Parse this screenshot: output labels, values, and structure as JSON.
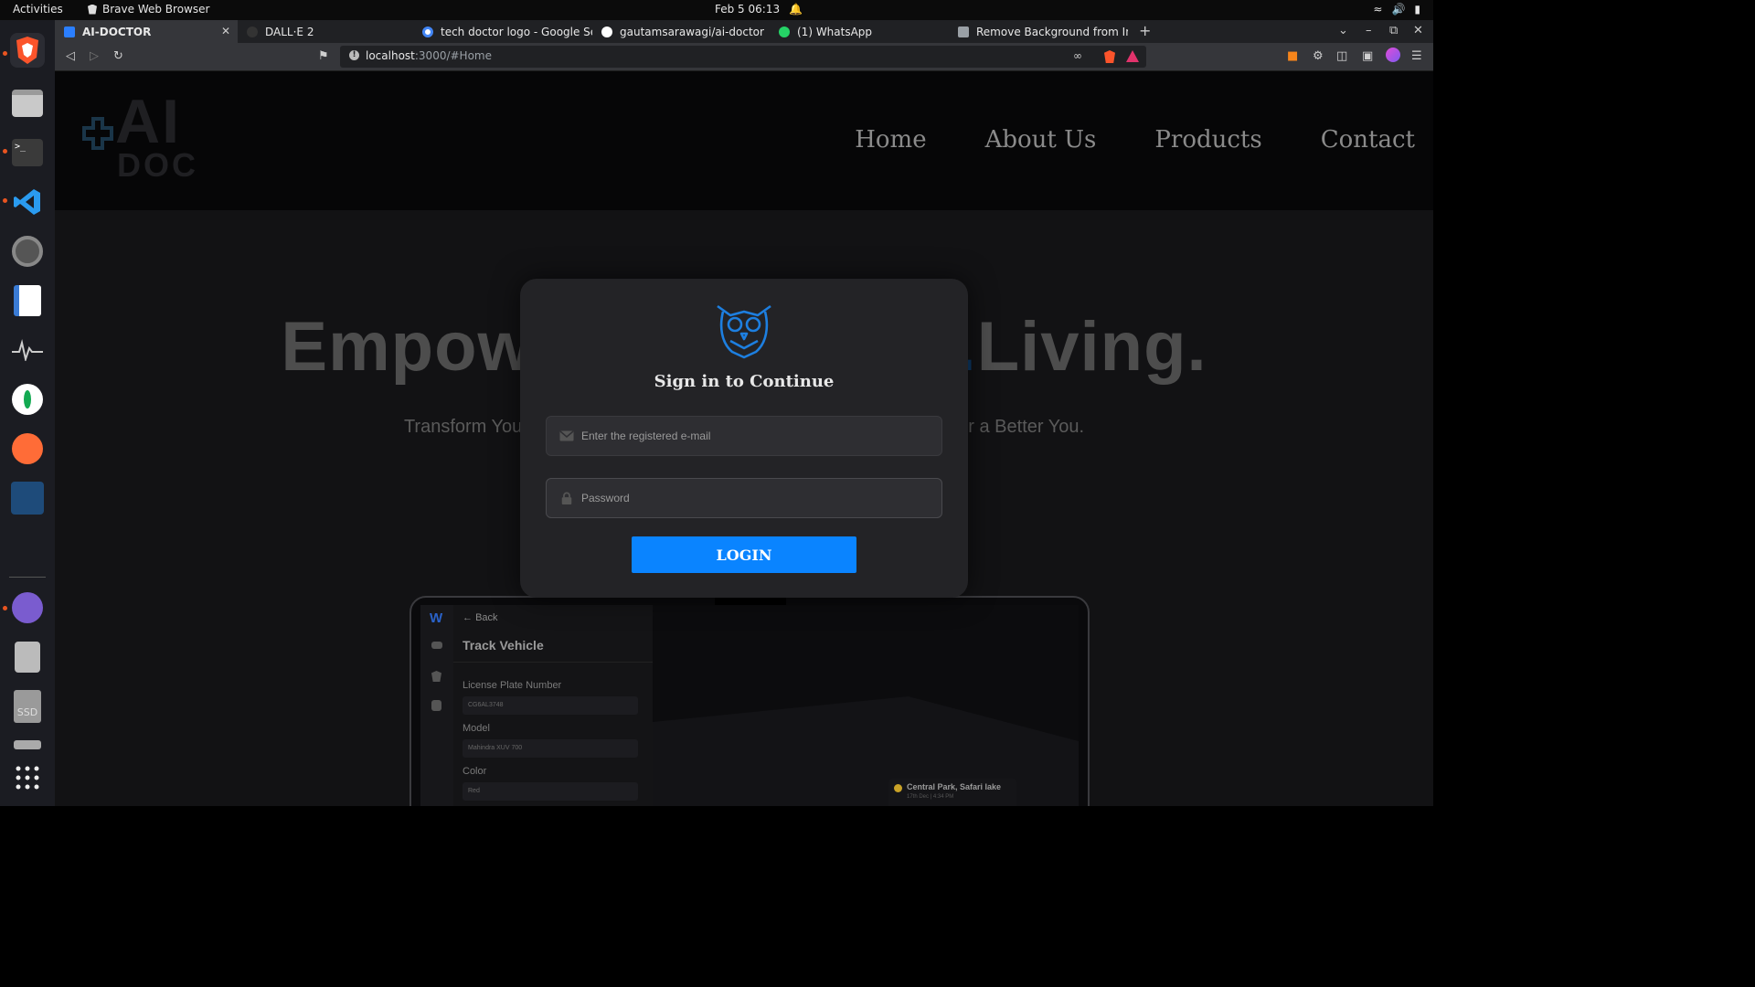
{
  "system": {
    "activities": "Activities",
    "app_name": "Brave Web Browser",
    "clock": "Feb 5  06:13"
  },
  "browser": {
    "tabs": [
      {
        "label": "AI-DOCTOR",
        "active": true,
        "favicon_color": "#2b7fff"
      },
      {
        "label": "DALL·E 2",
        "active": false,
        "favicon_color": "#333"
      },
      {
        "label": "tech doctor logo - Google Sea",
        "active": false,
        "favicon_color": "#ffffff"
      },
      {
        "label": "gautamsarawagi/ai-doctor",
        "active": false,
        "favicon_color": "#ffffff"
      },
      {
        "label": "(1) WhatsApp",
        "active": false,
        "favicon_color": "#25d366"
      },
      {
        "label": "Remove Background from Ima",
        "active": false,
        "favicon_color": "#9aa0a6"
      }
    ],
    "url_host": "localhost",
    "url_rest": ":3000/#Home"
  },
  "site": {
    "logo_text_top": "AI",
    "logo_text_bottom": "DOC",
    "nav": [
      "Home",
      "About Us",
      "Products",
      "Contact"
    ],
    "hero_left": "Empow",
    "hero_accent": ".",
    "hero_right": "Living.",
    "hero_sub_left": "Transform You",
    "hero_sub_right": "r a Better You."
  },
  "mockup": {
    "back": "Back",
    "title": "Track Vehicle",
    "fields": [
      {
        "label": "License Plate Number",
        "value": "CG6AL3748"
      },
      {
        "label": "Model",
        "value": "Mahindra XUV 700"
      },
      {
        "label": "Color",
        "value": "Red"
      }
    ],
    "map_card_title": "Central Park, Safari lake",
    "map_card_sub": "17th Dec | 4:34 PM"
  },
  "login": {
    "title": "Sign in to Continue",
    "email_placeholder": "Enter the registered e-mail",
    "password_placeholder": "Password",
    "button": "LOGIN"
  },
  "colors": {
    "accent": "#0a84ff",
    "owl": "#1d7fe0"
  }
}
